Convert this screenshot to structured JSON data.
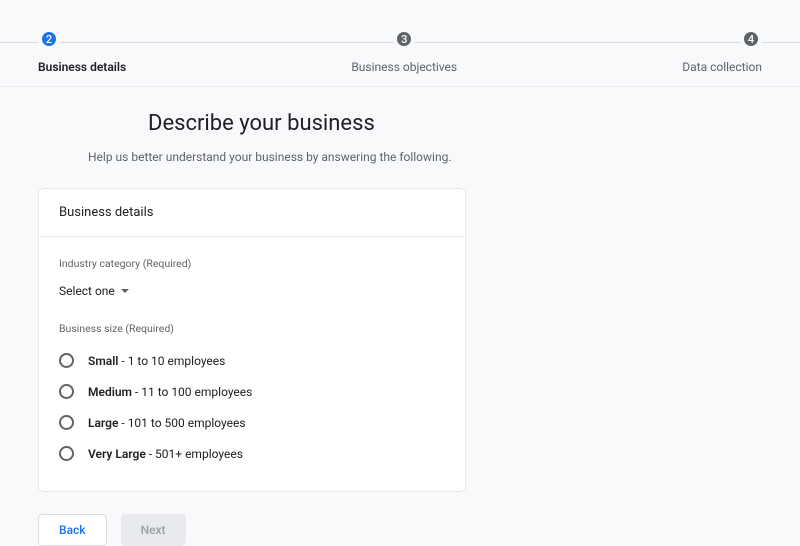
{
  "stepper": {
    "steps": [
      {
        "number": "2",
        "label": "Business details",
        "active": true
      },
      {
        "number": "3",
        "label": "Business objectives",
        "active": false
      },
      {
        "number": "4",
        "label": "Data collection",
        "active": false
      }
    ]
  },
  "page": {
    "title": "Describe your business",
    "subtitle": "Help us better understand your business by answering the following."
  },
  "card": {
    "header": "Business details",
    "industry": {
      "label": "Industry category (Required)",
      "select_text": "Select one"
    },
    "size": {
      "label": "Business size (Required)",
      "options": [
        {
          "name": "Small",
          "desc": " - 1 to 10 employees"
        },
        {
          "name": "Medium",
          "desc": " - 11 to 100 employees"
        },
        {
          "name": "Large",
          "desc": " - 101 to 500 employees"
        },
        {
          "name": "Very Large",
          "desc": " - 501+ employees"
        }
      ]
    }
  },
  "buttons": {
    "back": "Back",
    "next": "Next"
  }
}
